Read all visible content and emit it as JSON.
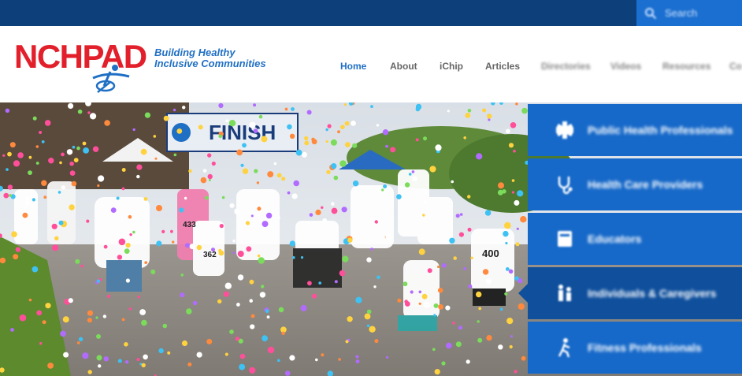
{
  "search": {
    "placeholder": "Search"
  },
  "logo": {
    "text": "NCHPAD"
  },
  "tagline": {
    "line1": "Building Healthy",
    "line2": "Inclusive Communities"
  },
  "nav": {
    "items": [
      {
        "label": "Home",
        "active": true,
        "blurred": false
      },
      {
        "label": "About",
        "active": false,
        "blurred": false
      },
      {
        "label": "iChip",
        "active": false,
        "blurred": false
      },
      {
        "label": "Articles",
        "active": false,
        "blurred": false
      },
      {
        "label": "Directories",
        "active": false,
        "blurred": true
      },
      {
        "label": "Videos",
        "active": false,
        "blurred": true
      },
      {
        "label": "Resources",
        "active": false,
        "blurred": true
      },
      {
        "label": "Co",
        "active": false,
        "blurred": true
      }
    ]
  },
  "hero": {
    "banner_text": "FINISH",
    "bibs": [
      "433",
      "362",
      "400"
    ]
  },
  "sidemenu": {
    "items": [
      {
        "label": "Public Health Professionals",
        "icon": "caduceus-icon"
      },
      {
        "label": "Health Care Providers",
        "icon": "stethoscope-icon"
      },
      {
        "label": "Educators",
        "icon": "book-icon"
      },
      {
        "label": "Individuals & Caregivers",
        "icon": "people-icon",
        "active": true
      },
      {
        "label": "Fitness Professionals",
        "icon": "runner-icon"
      }
    ]
  },
  "colors": {
    "topbar": "#0d3f7a",
    "search": "#1b6fd0",
    "brand_red": "#e2202b",
    "brand_blue": "#1f6fc4",
    "menu": "#1769c9",
    "menu_active": "#0f4f9c"
  }
}
